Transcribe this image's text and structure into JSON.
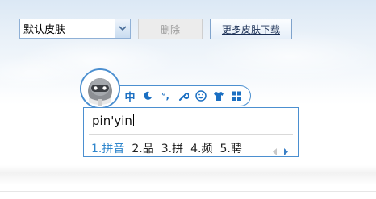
{
  "skin_select": {
    "value": "默认皮肤"
  },
  "buttons": {
    "delete_label": "删除",
    "more_skins_label": "更多皮肤下载"
  },
  "ime_toolbar": {
    "items": [
      {
        "name": "chinese-mode-icon",
        "glyph": "中"
      },
      {
        "name": "half-width-moon-icon"
      },
      {
        "name": "punctuation-icon",
        "glyph": "°,"
      },
      {
        "name": "wrench-icon"
      },
      {
        "name": "emoji-smiley-icon"
      },
      {
        "name": "skin-shirt-icon"
      },
      {
        "name": "toolbox-grid-icon"
      }
    ]
  },
  "ime_candidate": {
    "input_text": "pin'yin",
    "candidates": [
      "1.拼音",
      "2.品",
      "3.拼",
      "4.频",
      "5.聘"
    ]
  },
  "colors": {
    "accent": "#4b8fd0",
    "highlight": "#2f86cc",
    "icon_blue": "#1b6fc2"
  }
}
